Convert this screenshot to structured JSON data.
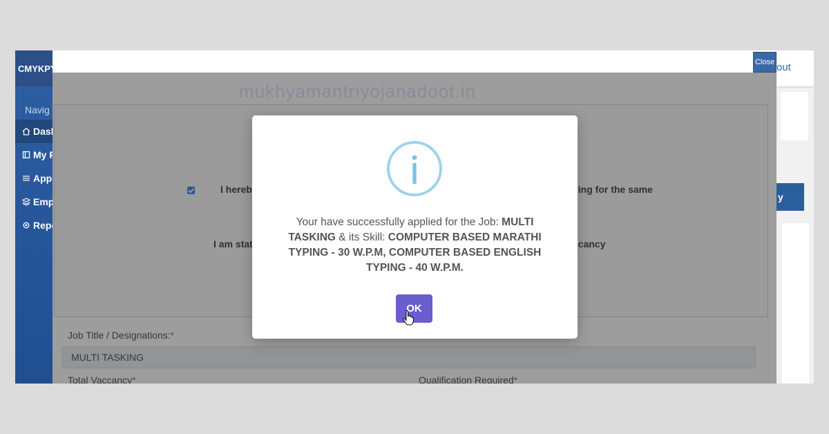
{
  "sidebar": {
    "brand": "CMYKPY",
    "nav_heading": "Navig",
    "items": [
      {
        "label": "Dash",
        "icon": "home-icon"
      },
      {
        "label": "My P",
        "icon": "book-icon"
      },
      {
        "label": "Appl",
        "icon": "list-icon"
      },
      {
        "label": "Emp",
        "icon": "layers-icon"
      },
      {
        "label": "Repo",
        "icon": "cog-icon"
      }
    ]
  },
  "background": {
    "logout_label": "out",
    "side_button_label": "y"
  },
  "modal": {
    "close_label": "Close",
    "watermark": "mukhyamantriyojanadoot.in",
    "declaration_1_start": "I hereby",
    "declaration_1_end": "ying for the same",
    "declaration_2_start": "I am stati",
    "declaration_2_end": "ccancy",
    "job_title_label": "Job Title / Designations:",
    "job_title_value": "MULTI TASKING",
    "total_vacancy_label": "Total Vaccancy",
    "qualification_label": "Qualification Required",
    "required_marker": "*"
  },
  "dialog": {
    "message_prefix": "Your have successfully applied for the Job: ",
    "job": "MULTI TASKING",
    "message_middle": " & its Skill: ",
    "skill": "COMPUTER BASED MARATHI TYPING - 30 W.P.M, COMPUTER BASED ENGLISH TYPING - 40 W.P.M.",
    "ok_label": "OK",
    "icon": "info-icon"
  },
  "colors": {
    "sidebar": "#1f4f92",
    "ok_button": "#6a5dcf",
    "info_icon": "#8ecbe6",
    "close_button": "#3a69a5"
  }
}
